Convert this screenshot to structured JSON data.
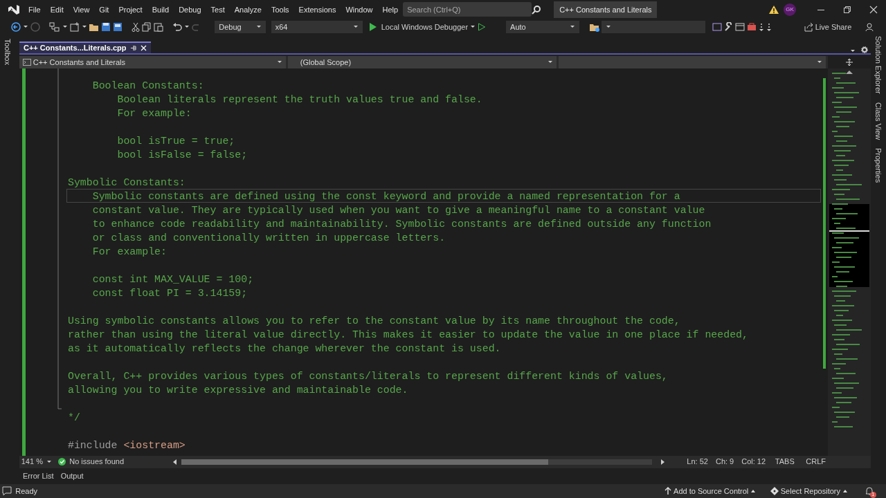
{
  "menu": [
    "File",
    "Edit",
    "View",
    "Git",
    "Project",
    "Build",
    "Debug",
    "Test",
    "Analyze",
    "Tools",
    "Extensions",
    "Window",
    "Help"
  ],
  "search": {
    "placeholder": "Search (Ctrl+Q)"
  },
  "solution_title": "C++ Constants and Literals",
  "user_initials": "GK",
  "toolbar": {
    "configuration": "Debug",
    "platform": "x64",
    "debugger": "Local Windows Debugger",
    "target": "Auto",
    "live_share": "Live Share"
  },
  "left_tool_tabs": [
    "Toolbox"
  ],
  "right_tool_tabs": [
    "Solution Explorer",
    "Class View",
    "Properties"
  ],
  "document_tabs": [
    {
      "label": "C++ Constants...Literals.cpp",
      "selected": true
    }
  ],
  "nav_bar": {
    "project": "C++ Constants and Literals",
    "scope": "(Global Scope)"
  },
  "code_lines": [
    {
      "kind": "comment",
      "current": false
    },
    {
      "kind": "comment",
      "text": "    Boolean Constants:",
      "current": false
    },
    {
      "kind": "comment",
      "text": "        Boolean literals represent the truth values true and false.",
      "current": false
    },
    {
      "kind": "comment",
      "text": "        For example:",
      "current": false
    },
    {
      "kind": "comment",
      "current": false
    },
    {
      "kind": "comment",
      "text": "        bool isTrue = true;",
      "current": false
    },
    {
      "kind": "comment",
      "text": "        bool isFalse = false;",
      "current": false
    },
    {
      "kind": "comment",
      "current": false
    },
    {
      "kind": "comment",
      "text": "Symbolic Constants:",
      "current": false
    },
    {
      "kind": "comment",
      "text": "    Symbolic constants are defined using the const keyword and provide a named representation for a",
      "current": true
    },
    {
      "kind": "comment",
      "text": "    constant value. They are typically used when you want to give a meaningful name to a constant value",
      "current": false
    },
    {
      "kind": "comment",
      "text": "    to enhance code readability and maintainability. Symbolic constants are defined outside any function",
      "current": false
    },
    {
      "kind": "comment",
      "text": "    or class and conventionally written in uppercase letters.",
      "current": false
    },
    {
      "kind": "comment",
      "text": "    For example:",
      "current": false
    },
    {
      "kind": "comment",
      "current": false
    },
    {
      "kind": "comment",
      "text": "    const int MAX_VALUE = 100;",
      "current": false
    },
    {
      "kind": "comment",
      "text": "    const float PI = 3.14159;",
      "current": false
    },
    {
      "kind": "comment",
      "current": false
    },
    {
      "kind": "comment",
      "text": "Using symbolic constants allows you to refer to the constant value by its name throughout the code,",
      "current": false
    },
    {
      "kind": "comment",
      "text": "rather than using the literal value directly. This makes it easier to update the value in one place if needed,",
      "current": false
    },
    {
      "kind": "comment",
      "text": "as it automatically reflects the change wherever the constant is used.",
      "current": false
    },
    {
      "kind": "comment",
      "current": false
    },
    {
      "kind": "comment",
      "text": "Overall, C++ provides various types of constants/literals to represent different kinds of values,",
      "current": false
    },
    {
      "kind": "comment",
      "text": "allowing you to write expressive and maintainable code.",
      "current": false
    },
    {
      "kind": "comment",
      "current": false
    },
    {
      "kind": "comment",
      "text": "*/",
      "current": false
    },
    {
      "kind": "plain",
      "current": false
    },
    {
      "kind": "directive",
      "text": "#include",
      "argument": "<iostream>",
      "current": false
    }
  ],
  "editor_status": {
    "zoom": "141 %",
    "issues": "No issues found",
    "line": "Ln: 52",
    "char": "Ch: 9",
    "column": "Col: 12",
    "indent": "TABS",
    "line_ending": "CRLF"
  },
  "bottom_tabs": [
    "Error List",
    "Output"
  ],
  "status_bar": {
    "state": "Ready",
    "source_control": "Add to Source Control",
    "repository": "Select Repository",
    "notifications": "1"
  }
}
